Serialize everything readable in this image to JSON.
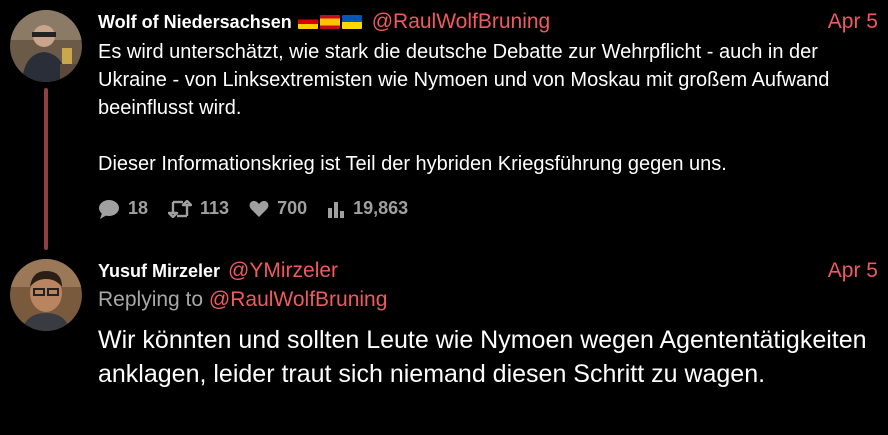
{
  "tweets": [
    {
      "display_name": "Wolf of Niedersachsen",
      "flags": [
        "flag-germany-icon",
        "flag-spain-icon",
        "flag-ukraine-icon"
      ],
      "handle": "@RaulWolfBruning",
      "date": "Apr 5",
      "text": "Es wird unterschätzt, wie stark die deutsche Debatte zur Wehrpflicht - auch in der Ukraine - von Linksextremisten wie Nymoen und von Moskau mit großem Aufwand beeinflusst wird.\n\nDieser Informationskrieg ist Teil der hybriden Kriegsführung gegen uns.",
      "stats": {
        "replies": "18",
        "retweets": "113",
        "likes": "700",
        "views": "19,863"
      }
    },
    {
      "display_name": "Yusuf Mirzeler",
      "handle": "@YMirzeler",
      "date": "Apr 5",
      "replying_to_label": "Replying to",
      "replying_to_handle": "@RaulWolfBruning",
      "text": "Wir könnten und sollten Leute wie Nymoen wegen Agententätigkeiten anklagen, leider traut sich niemand diesen Schritt zu wagen."
    }
  ],
  "colors": {
    "background": "#000000",
    "accent": "#f05a5e",
    "thread_line": "#8e4044",
    "muted": "#a0a0a0"
  }
}
